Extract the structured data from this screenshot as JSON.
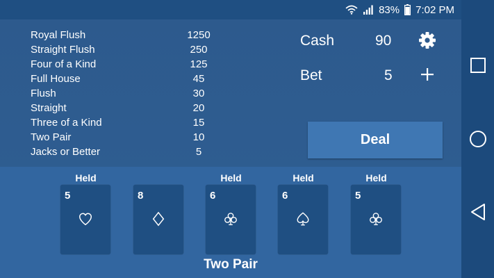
{
  "status_bar": {
    "battery": "83%",
    "time": "7:02 PM"
  },
  "paytable": [
    {
      "hand": "Royal Flush",
      "payout": "1250"
    },
    {
      "hand": "Straight Flush",
      "payout": "250"
    },
    {
      "hand": "Four of a Kind",
      "payout": "125"
    },
    {
      "hand": "Full House",
      "payout": "45"
    },
    {
      "hand": "Flush",
      "payout": "30"
    },
    {
      "hand": "Straight",
      "payout": "20"
    },
    {
      "hand": "Three of a Kind",
      "payout": "15"
    },
    {
      "hand": "Two Pair",
      "payout": "10"
    },
    {
      "hand": "Jacks or Better",
      "payout": "5"
    }
  ],
  "cash": {
    "label": "Cash",
    "value": "90"
  },
  "bet": {
    "label": "Bet",
    "value": "5"
  },
  "deal_button": {
    "label": "Deal"
  },
  "cards": [
    {
      "held": "Held",
      "rank": "5",
      "suit": "heart"
    },
    {
      "held": "",
      "rank": "8",
      "suit": "diamond"
    },
    {
      "held": "Held",
      "rank": "6",
      "suit": "club"
    },
    {
      "held": "Held",
      "rank": "6",
      "suit": "spade"
    },
    {
      "held": "Held",
      "rank": "5",
      "suit": "club"
    }
  ],
  "hand_result": "Two Pair",
  "nav": {
    "icons": [
      "recents-square-icon",
      "home-circle-icon",
      "back-triangle-icon"
    ]
  }
}
